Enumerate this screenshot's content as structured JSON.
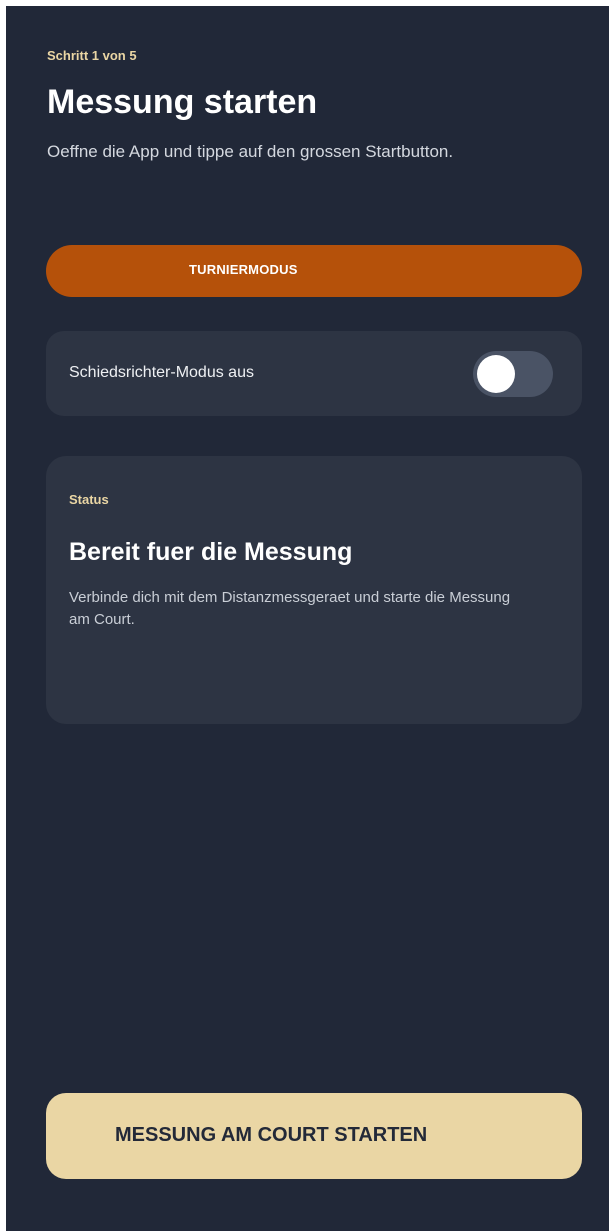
{
  "header": {
    "step": "Schritt 1 von 5",
    "title": "Messung starten",
    "subtitle": "Oeffne die App und tippe auf den grossen Startbutton."
  },
  "tournament": {
    "label": "TURNIERMODUS"
  },
  "referee": {
    "label": "Schiedsrichter-Modus aus",
    "enabled": false
  },
  "status": {
    "label": "Status",
    "title": "Bereit fuer die Messung",
    "text": "Verbinde dich mit dem Distanzmessgeraet und starte die Messung am Court."
  },
  "start": {
    "label": "MESSUNG AM COURT STARTEN"
  },
  "colors": {
    "background": "#212838",
    "card": "#2d3443",
    "accent_orange": "#b5510a",
    "accent_gold": "#ead6a4"
  }
}
